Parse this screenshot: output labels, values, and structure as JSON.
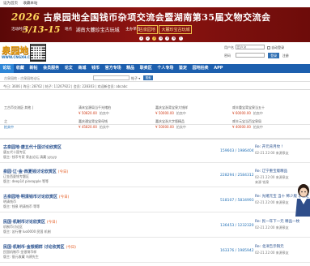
{
  "topbar": {
    "items": [
      "设为首页",
      "收藏本站"
    ]
  },
  "banner": {
    "year": "2026",
    "title": "古泉园地全国钱币杂项交流会暨湖南第35届文物交流会",
    "date_label": "活动时间",
    "date": "3/13-15",
    "place_label": "地点",
    "place": "湖南大麓珍宝古玩城",
    "host_label": "主办单位",
    "host": "古泉园地",
    "co_host": "大麓珍宝古玩城",
    "dots": [
      "1",
      "2",
      "3",
      "4",
      "5",
      "6",
      "7"
    ],
    "active_dot": 2
  },
  "header": {
    "logo": "泉园地",
    "logo_url": "WWW.CNGXH.COM",
    "username_label": "用户名",
    "username_placeholder": "用户名",
    "password_label": "密码",
    "autologin": "自动登录",
    "login_button": "登录",
    "register": "注册"
  },
  "nav": {
    "items": [
      "论坛",
      "收藏",
      "新帖",
      "会员服务",
      "论文",
      "商城",
      "钱币",
      "官方专场",
      "精品",
      "联卖区",
      "个人专场",
      "鉴定",
      "园地拍卖",
      "APP"
    ],
    "active": 0
  },
  "breadcrumb": {
    "text": "古泉园地 › 古泉园地论坛",
    "search_dropdown": "帖子 ▾",
    "search_button": "搜索"
  },
  "stats": "今日: 3606 | 昨日: 28762 | 帖子: 11267922 | 会员: 228303 | 欢迎新会员: abcabc",
  "featured": [
    [
      {
        "title": "工古币交流区·其他 |",
        "meta": "",
        "sold": ""
      },
      {
        "title": "清末宝源局当千光绪拍",
        "price": "¥ 50820.00",
        "status": "拍卖中"
      },
      {
        "title": "嘉庆宝浙背宝泉大钱样",
        "price": "¥ 50000.00",
        "status": "拍卖中"
      },
      {
        "title": "咸丰重宝背宝泉当五十",
        "price": "¥ 60000.00",
        "status": "拍卖中"
      }
    ],
    [
      {
        "title": "之",
        "meta": "",
        "sold": "拍卖中"
      },
      {
        "title": "嘉庆通宝背宝泉母钱",
        "price": "¥ 45820.00",
        "status": "拍卖中"
      },
      {
        "title": "嘉庆宝浙大字版精品",
        "price": "¥ 50000.00",
        "status": "拍卖中"
      },
      {
        "title": "咸丰元宝当百宝泉局",
        "price": "¥ 40000.00",
        "status": "拍卖中"
      }
    ]
  ],
  "forums": [
    {
      "title": "古泉园地·唐五代十国讨论欣赏区",
      "badge": "",
      "line1": "唐五代十国专区",
      "line2": "版主: 钱币专家 泉友论坛 清藏 yyyyy",
      "count": "159603 / 1986404",
      "last_title": "Re: 开元背月纹 !",
      "last_meta": "02-21 22:00 来源泉友",
      "last_by": ""
    },
    {
      "title": "泉园·辽·金·西夏钱讨论欣赏区",
      "badge": "(今日)",
      "line1": "辽金西夏钱专题区",
      "line2": "版主: deep14 pineapple 等等",
      "count": "228294 / 2584312",
      "last_title": "Re: 辽宁重宝版精品",
      "last_meta": "02-21 22:00 来源泉友",
      "last_by": "来源 钱泉"
    },
    {
      "title": "古泉园地·明清钱币讨论欣赏区",
      "badge": "(今日)",
      "line1": "明清钱币",
      "line2": "版主: 钱泉 明清钱币 等等",
      "count": "518107 / 5834993",
      "last_title": "Re: 光绪元宝 当十 稀少版 求鉴定",
      "last_meta": "02-21 22:00 来源泉友",
      "last_by": ""
    },
    {
      "title": "民国·机制币讨论欣赏区",
      "badge": "(今日)",
      "line1": "机制币讨论区",
      "line2": "版主: 苦行僧 luo0000 民国 机制",
      "count": "136453 / 1232320",
      "last_title": "Re: 民一年下一元 精品一枚",
      "last_meta": "02-21 22:00 来源泉友",
      "last_by": ""
    },
    {
      "title": "民国·机制币·金银铜样 讨论欣赏区",
      "badge": "(今日)",
      "line1": "民国机制币 金银铜币样",
      "line2": "版主: 银元收藏 乌鸦先生",
      "count": "163376 / 1985942",
      "last_title": "Re: 北洋告示铜元",
      "last_meta": "02-21 22:00 来源泉友",
      "last_by": ""
    }
  ],
  "colors": {
    "nav_bg": "#1d5fae",
    "banner_bg": "#7a0d0b",
    "accent_gold": "#ffd75c",
    "link": "#1f6eb5"
  }
}
